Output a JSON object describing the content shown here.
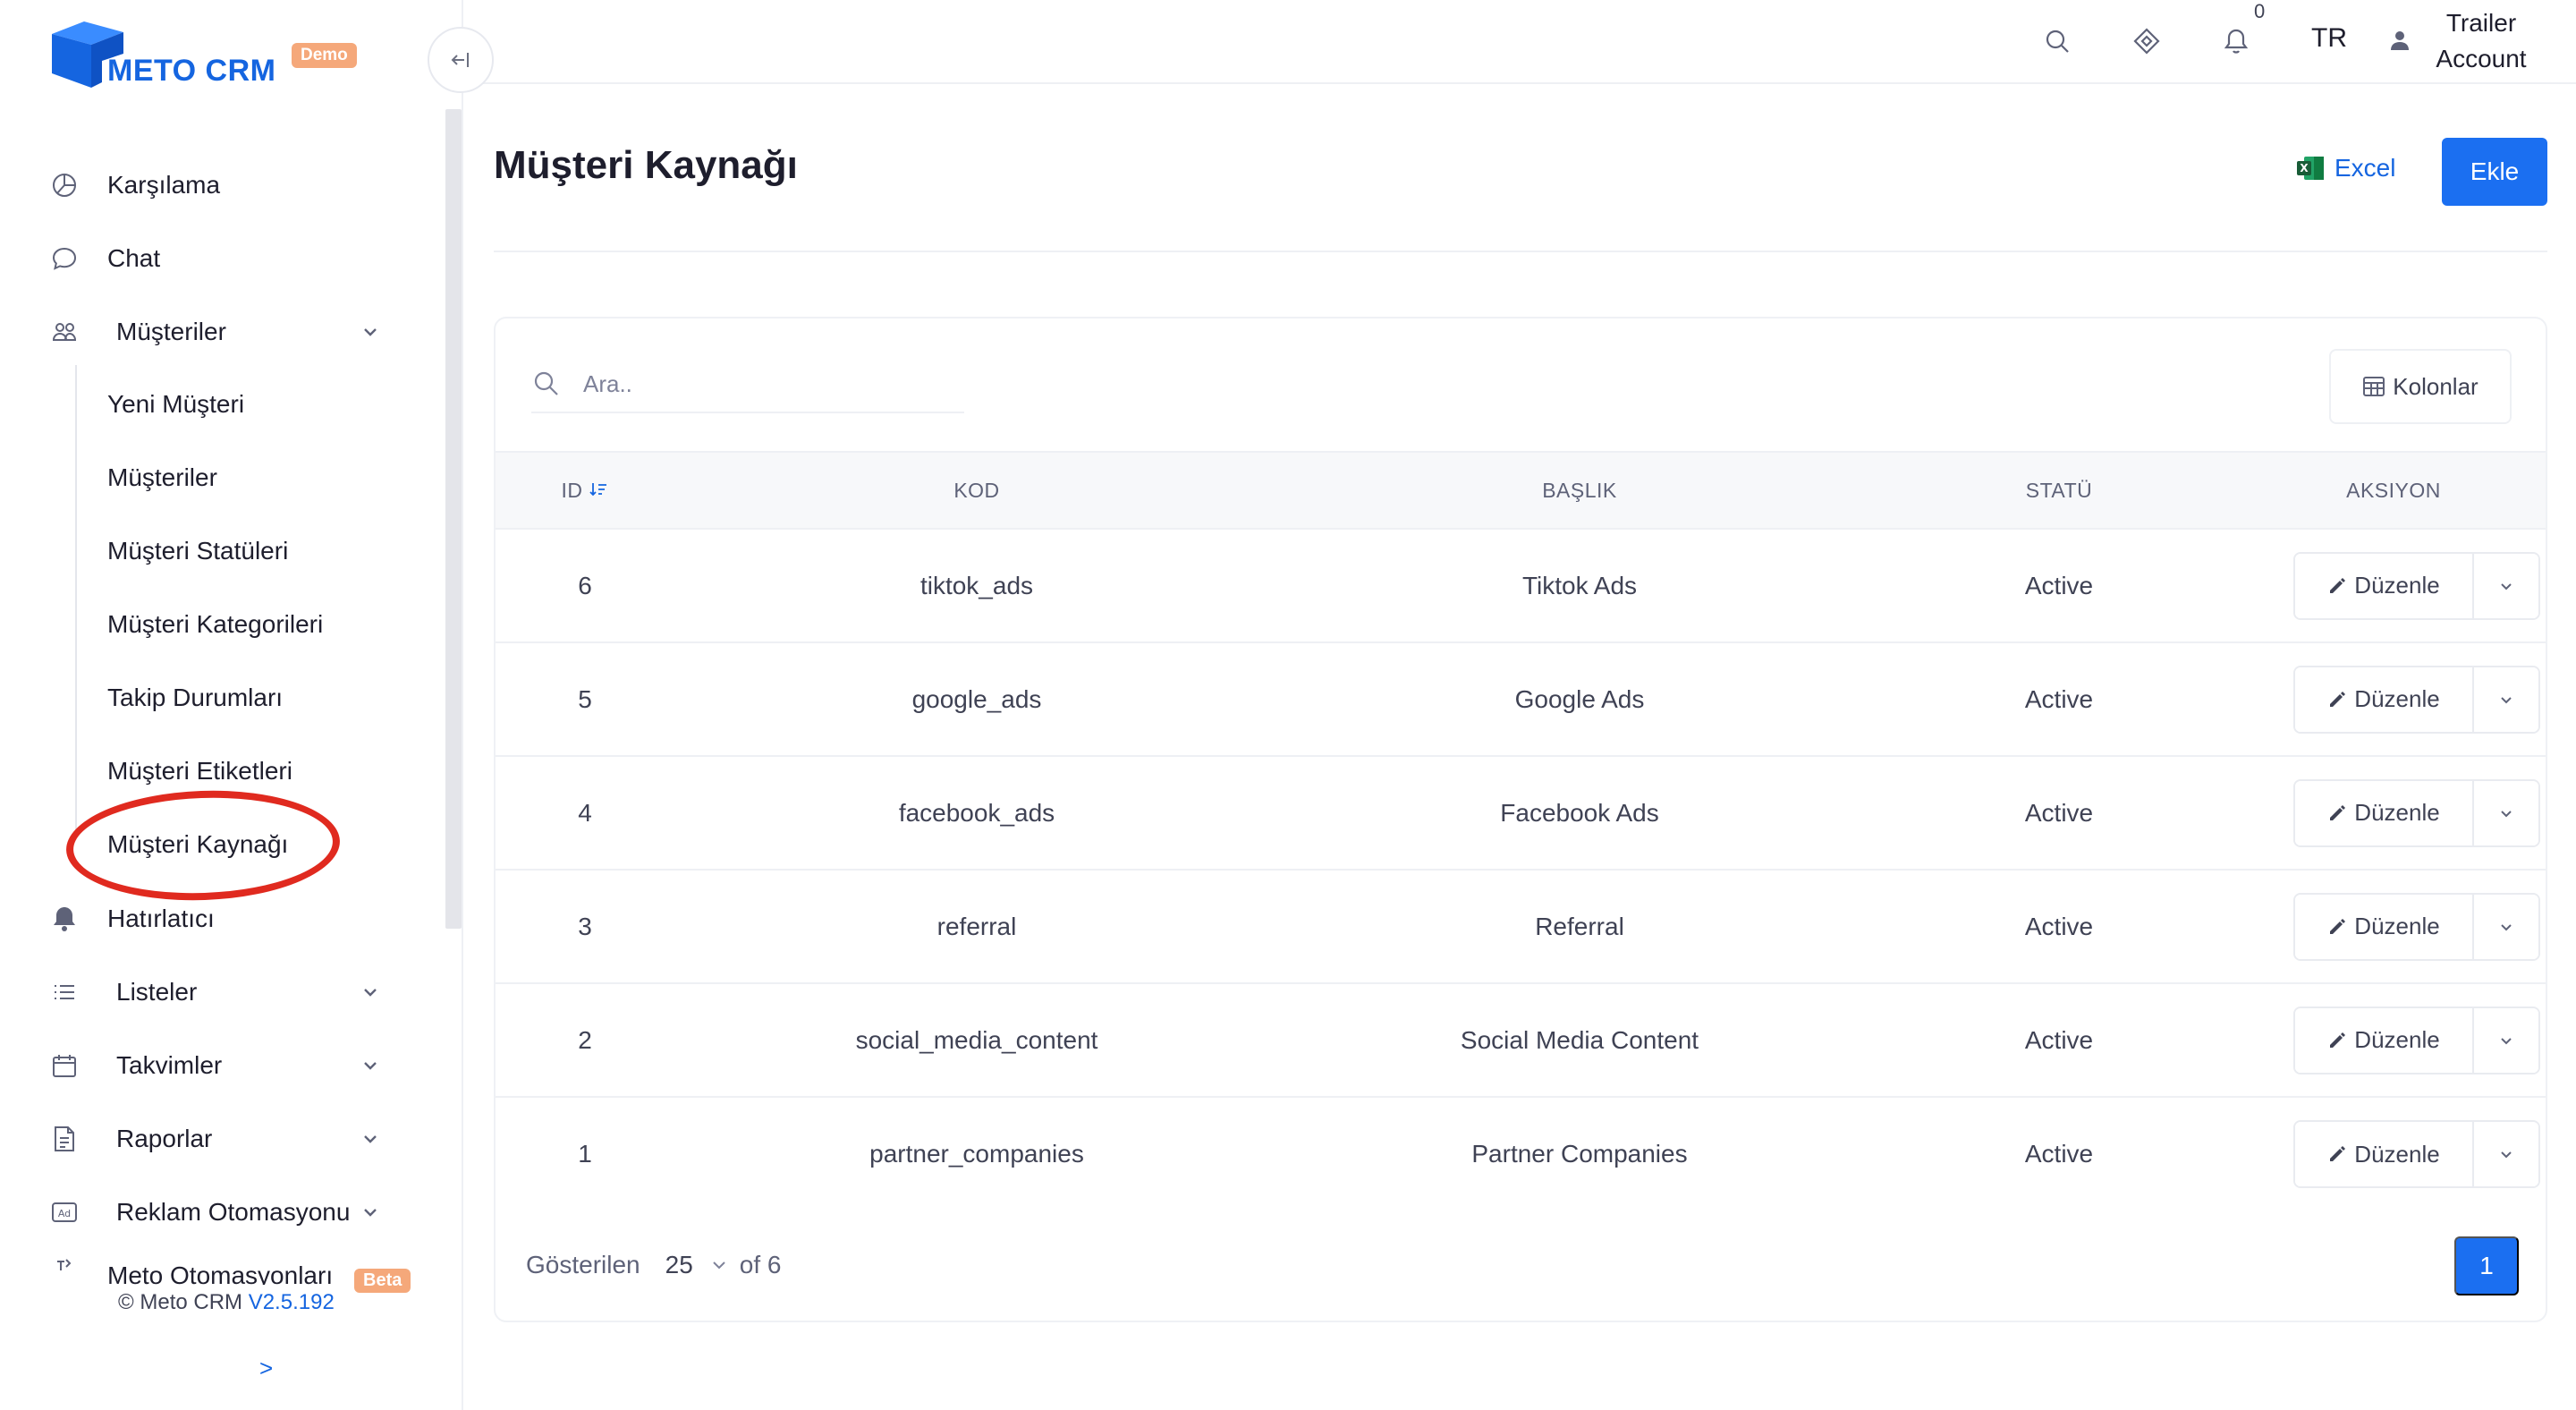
{
  "brand": {
    "name": "METO CRM",
    "badge": "Demo",
    "primary_color": "#1b6ff1",
    "accent_color": "#f5a87a"
  },
  "sidebar": {
    "items": [
      {
        "label": "Karşılama",
        "icon": "dashboard-icon"
      },
      {
        "label": "Chat",
        "icon": "chat-bubble-icon"
      },
      {
        "label": "Müşteriler",
        "icon": "users-icon",
        "expanded": true
      },
      {
        "label": "Hatırlatıcı",
        "icon": "bell-icon"
      },
      {
        "label": "Listeler",
        "icon": "list-icon"
      },
      {
        "label": "Takvimler",
        "icon": "calendar-icon"
      },
      {
        "label": "Raporlar",
        "icon": "document-icon"
      },
      {
        "label": "Reklam Otomasyonu",
        "icon": "ad-icon"
      },
      {
        "label": "Meto Otomasyonları",
        "icon": "automation-icon",
        "badge": "Beta"
      }
    ],
    "submenu": [
      "Yeni Müşteri",
      "Müşteriler",
      "Müşteri Statüleri",
      "Müşteri Kategorileri",
      "Takip Durumları",
      "Müşteri Etiketleri",
      "Müşteri Kaynağı"
    ],
    "copyright": "© Meto CRM",
    "version": "V2.5.192",
    "expand_label": ">"
  },
  "topbar": {
    "notifications_count": "0",
    "language": "TR",
    "user_line1": "Trailer",
    "user_line2": "Account"
  },
  "page": {
    "title": "Müşteri Kaynağı",
    "excel_label": "Excel",
    "add_label": "Ekle"
  },
  "table": {
    "search_placeholder": "Ara..",
    "columns_label": "Kolonlar",
    "headers": {
      "id": "ID",
      "code": "KOD",
      "title": "BAŞLIK",
      "status": "STATÜ",
      "action": "AKSIYON"
    },
    "rows": [
      {
        "id": "6",
        "code": "tiktok_ads",
        "title": "Tiktok Ads",
        "status": "Active"
      },
      {
        "id": "5",
        "code": "google_ads",
        "title": "Google Ads",
        "status": "Active"
      },
      {
        "id": "4",
        "code": "facebook_ads",
        "title": "Facebook Ads",
        "status": "Active"
      },
      {
        "id": "3",
        "code": "referral",
        "title": "Referral",
        "status": "Active"
      },
      {
        "id": "2",
        "code": "social_media_content",
        "title": "Social Media Content",
        "status": "Active"
      },
      {
        "id": "1",
        "code": "partner_companies",
        "title": "Partner Companies",
        "status": "Active"
      }
    ],
    "edit_label": "Düzenle"
  },
  "pagination": {
    "shown_label": "Gösterilen",
    "page_size": "25",
    "of_label": "of 6",
    "current_page": "1"
  }
}
